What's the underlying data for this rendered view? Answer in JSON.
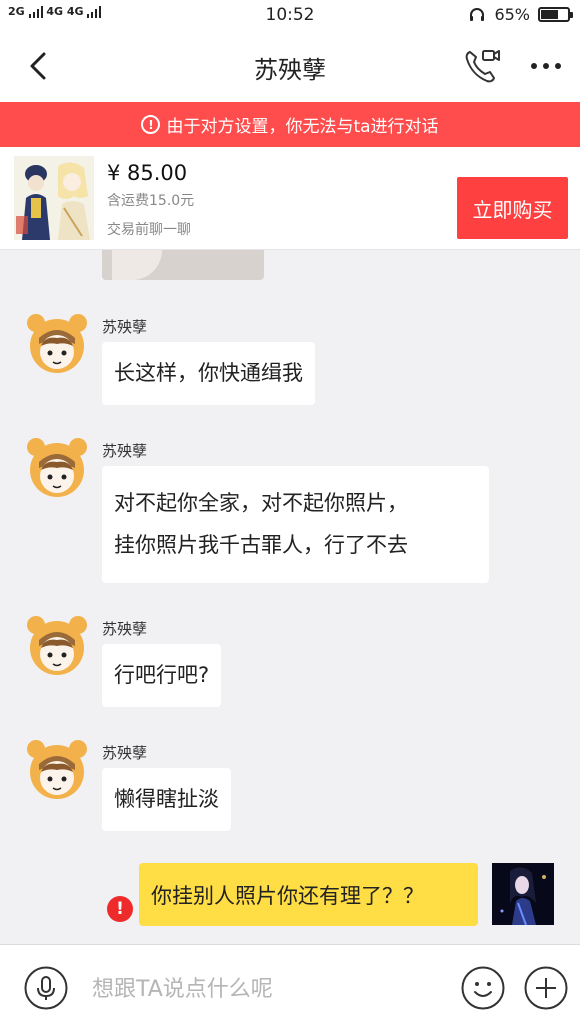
{
  "status_bar": {
    "network_1": "2G",
    "network_2": "4G 4G",
    "time": "10:52",
    "battery_percent": "65%",
    "battery_level": 0.65,
    "icons": [
      "signal-icon",
      "headset-icon",
      "battery-icon"
    ]
  },
  "nav": {
    "title": "苏殃孽",
    "icons": [
      "back-icon",
      "video-call-icon",
      "more-icon"
    ]
  },
  "banner": {
    "text": "由于对方设置，你无法与ta进行对话",
    "icon": "warning-icon",
    "color": "#ff4c4c"
  },
  "product": {
    "price": "¥ 85.00",
    "shipping": "含运费15.0元",
    "hint": "交易前聊一聊",
    "buy_label": "立即购买",
    "buy_color": "#ff4040"
  },
  "messages": [
    {
      "sender": "苏殃孽",
      "text": "长这样，你快通缉我"
    },
    {
      "sender": "苏殃孽",
      "lines": [
        "对不起你全家，对不起你照片，",
        "挂你照片我千古罪人，行了不去"
      ]
    },
    {
      "sender": "苏殃孽",
      "text": "行吧行吧?"
    },
    {
      "sender": "苏殃孽",
      "text": "懒得瞎扯淡"
    }
  ],
  "my_message": {
    "text": "你挂别人照片你还有理了？？",
    "status_icon": "send-failed-icon",
    "bubble_color": "#ffdd44"
  },
  "input_bar": {
    "placeholder": "想跟TA说点什么呢",
    "icons": [
      "microphone-icon",
      "emoji-icon",
      "plus-icon"
    ]
  }
}
